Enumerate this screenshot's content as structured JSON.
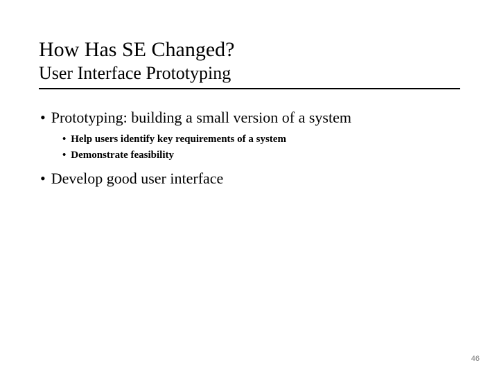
{
  "title": "How Has SE Changed?",
  "subtitle": "User Interface Prototyping",
  "bullets": [
    {
      "text": "Prototyping: building a small version of a system",
      "sub": [
        "Help users identify key requirements of a system",
        "Demonstrate feasibility"
      ]
    },
    {
      "text": "Develop good user interface",
      "sub": []
    }
  ],
  "page_number": "46"
}
